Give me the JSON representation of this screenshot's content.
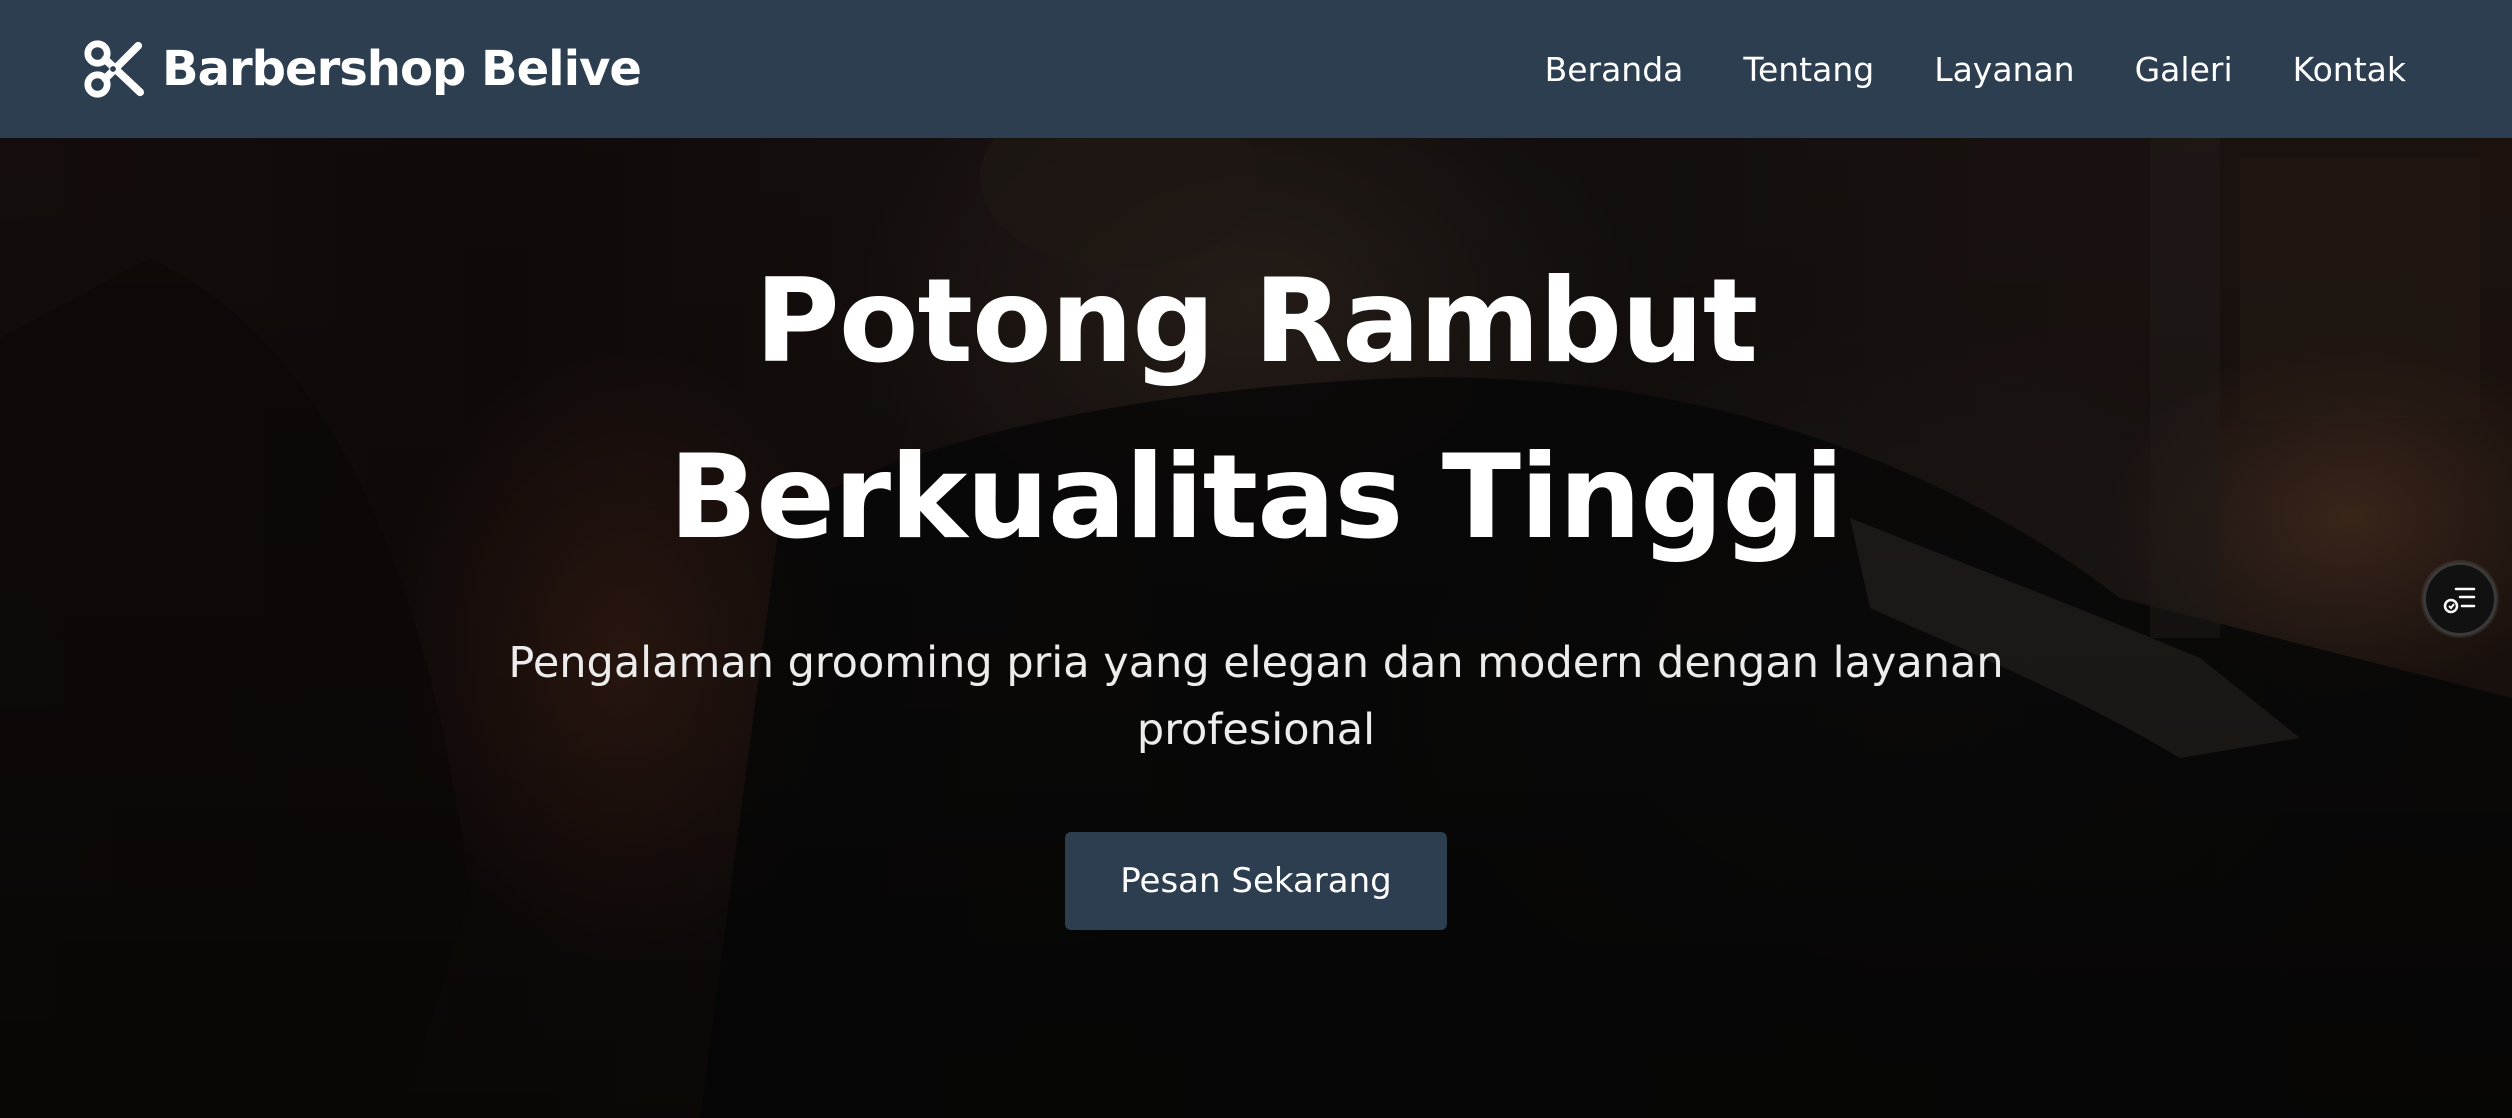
{
  "brand": {
    "name": "Barbershop Belive",
    "icon": "scissors-icon"
  },
  "nav": {
    "items": [
      {
        "label": "Beranda"
      },
      {
        "label": "Tentang"
      },
      {
        "label": "Layanan"
      },
      {
        "label": "Galeri"
      },
      {
        "label": "Kontak"
      }
    ]
  },
  "hero": {
    "title_line1": "Potong Rambut",
    "title_line2": "Berkualitas Tinggi",
    "subtitle": "Pengalaman grooming pria yang elegan dan modern dengan layanan profesional",
    "cta_label": "Pesan Sekarang"
  },
  "widget": {
    "icon": "accessibility-menu-icon"
  },
  "colors": {
    "navbar_bg": "#2c3e50",
    "button_bg": "#2c3e50",
    "text": "#ffffff"
  }
}
